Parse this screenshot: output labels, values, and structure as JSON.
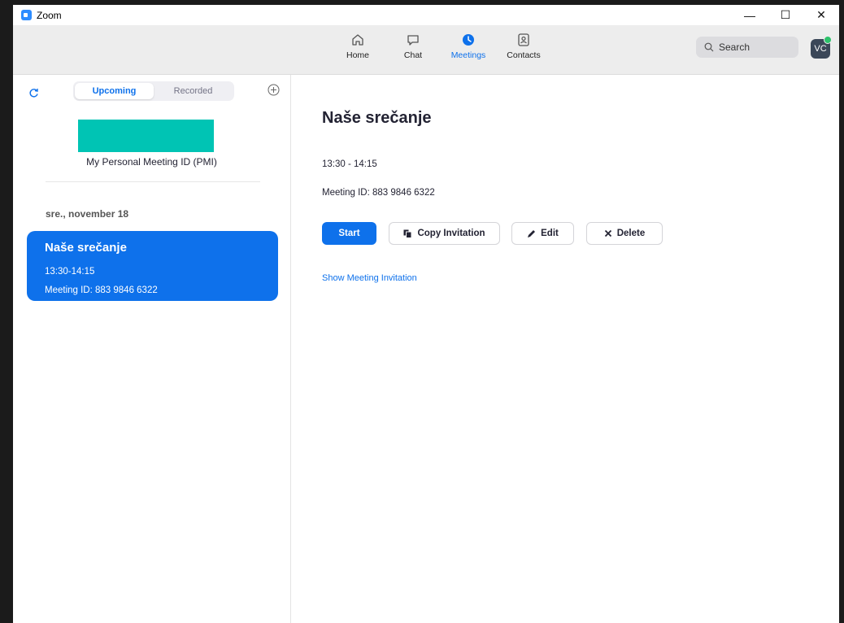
{
  "window": {
    "title": "Zoom",
    "controls": {
      "minimize": "—",
      "maximize": "☐",
      "close": "✕"
    }
  },
  "nav": {
    "items": [
      {
        "label": "Home",
        "icon": "home-icon"
      },
      {
        "label": "Chat",
        "icon": "chat-icon"
      },
      {
        "label": "Meetings",
        "icon": "meetings-icon",
        "active": true
      },
      {
        "label": "Contacts",
        "icon": "contacts-icon"
      }
    ]
  },
  "search": {
    "label": "Search"
  },
  "user": {
    "initials": "VC",
    "status_color": "#2dc26b"
  },
  "sidebar": {
    "tabs": {
      "upcoming": "Upcoming",
      "recorded": "Recorded"
    },
    "pmi_label": "My Personal Meeting ID (PMI)",
    "date_header": "sre., november 18",
    "meeting": {
      "title": "Naše srečanje",
      "time": "13:30-14:15",
      "meeting_id": "Meeting ID: 883 9846 6322"
    }
  },
  "detail": {
    "title": "Naše srečanje",
    "time": "13:30 - 14:15",
    "meeting_id": "Meeting ID: 883 9846 6322",
    "buttons": {
      "start": "Start",
      "copy": "Copy Invitation",
      "edit": "Edit",
      "delete": "Delete"
    },
    "show_invitation": "Show Meeting Invitation"
  },
  "colors": {
    "accent": "#0e71eb",
    "pmi_block": "#00c4b4"
  }
}
